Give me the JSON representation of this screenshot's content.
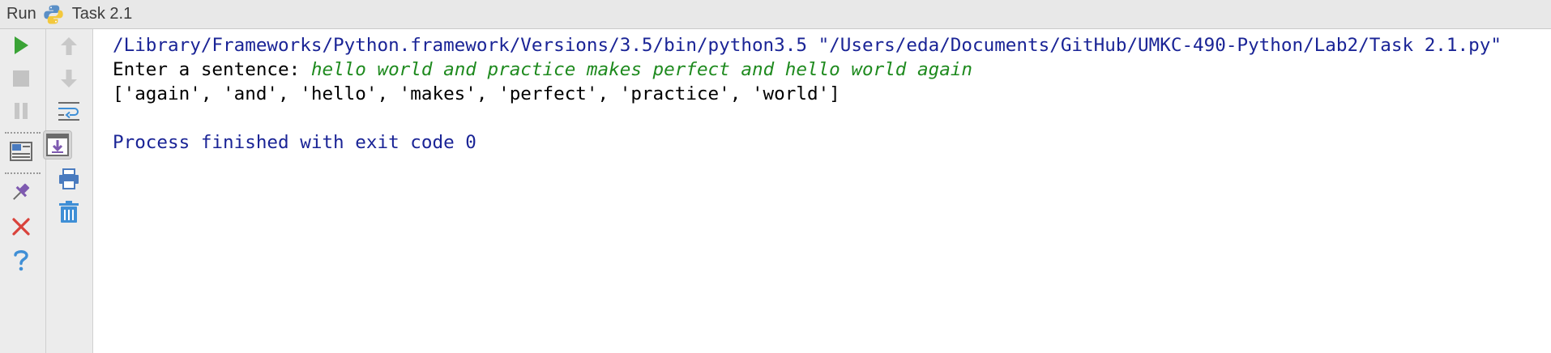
{
  "titlebar": {
    "run_label": "Run",
    "config_name": "Task 2.1"
  },
  "toolbar": {
    "left": [
      "run-icon",
      "stop-icon",
      "pause-icon",
      "layout-icon",
      "pin-icon",
      "close-icon",
      "help-icon"
    ],
    "right": [
      "up-arrow-icon",
      "down-arrow-icon",
      "soft-wrap-icon",
      "scroll-to-end-icon",
      "print-icon",
      "trash-icon"
    ]
  },
  "console": {
    "command": "/Library/Frameworks/Python.framework/Versions/3.5/bin/python3.5 \"/Users/eda/Documents/GitHub/UMKC-490-Python/Lab2/Task 2.1.py\"",
    "prompt": "Enter a sentence: ",
    "user_input": "hello world and practice makes perfect and hello world again",
    "output": "['again', 'and', 'hello', 'makes', 'perfect', 'practice', 'world']",
    "exit_message": "Process finished with exit code 0"
  },
  "colors": {
    "command": "#1a2496",
    "user_input": "#1e8a1e",
    "run_green": "#3aa336",
    "close_red": "#d9423b",
    "help_blue": "#3f8fd6"
  }
}
